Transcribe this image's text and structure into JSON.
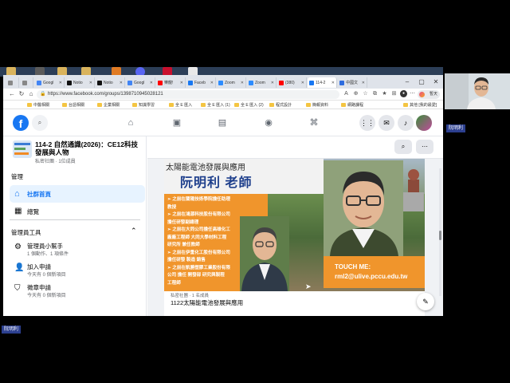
{
  "browser": {
    "tabs": [
      {
        "label": "Googl",
        "color": "#4285f4"
      },
      {
        "label": "Notio",
        "color": "#111111"
      },
      {
        "label": "Notio",
        "color": "#111111"
      },
      {
        "label": "Googl",
        "color": "#4285f4"
      },
      {
        "label": "樂龍!",
        "color": "#ff0000"
      },
      {
        "label": "Faceb",
        "color": "#1877f2"
      },
      {
        "label": "Zoom",
        "color": "#2d8cff"
      },
      {
        "label": "Zoom",
        "color": "#2d8cff"
      },
      {
        "label": "(380)",
        "color": "#ff0000"
      },
      {
        "label": "114-2",
        "color": "#1877f2",
        "active": true
      },
      {
        "label": "中國文",
        "color": "#2d6cdf"
      }
    ],
    "url": "https://www.facebook.com/groups/1398710945028121",
    "profile_label": "暫天",
    "bookmarks": [
      "中醫相關",
      "台語相關",
      "企業相關",
      "知識學習",
      "全 E 匯入",
      "全 E 匯入 (1)",
      "全 E 匯入 (2)",
      "程式設計",
      "簡報資料",
      "網路課程"
    ],
    "bookmarks_more": "其他 [我的最愛]"
  },
  "facebook": {
    "logo": "f",
    "group": {
      "name": "114-2 自然通識(2026)：CE12科技發展與人物",
      "meta": "私密社團 · 1位成員"
    },
    "sidebar": {
      "admin_heading": "管理",
      "home_label": "社群首頁",
      "overview_label": "總覽",
      "tools_heading": "管理員工具",
      "items": [
        {
          "label": "管理員小幫手",
          "sub": "1 個動作、1 項條件"
        },
        {
          "label": "加入申請",
          "sub": "今天有 0 個新項目"
        },
        {
          "label": "徵章申請",
          "sub": "今天有 0 個新項目"
        }
      ]
    },
    "banner": {
      "title": "太陽能電池發展與應用",
      "speaker": "阮明利  老師",
      "bio": [
        "➢ 之前在蘭陽技術學院擔任助理",
        "   教授",
        "➢ 之前在鴻源科技股份有限公司",
        "   擔任研發副總理",
        "➢ 之前在大同公司擔任高雄化工",
        "   廠廠工程師 大同大學材料工程",
        "   研究所 兼任教師",
        "➢ 之前在伊重化工股份有限公司",
        "   擔任研發 製造 銷售",
        "➢ 之前在凱勝塑膠工業股份有限",
        "   公司 擔任 開發部 研究與製程",
        "   工程師"
      ],
      "touch_label": "TOUCH ME:",
      "email": "rml2@ulive.pccu.edu.tw"
    },
    "post": {
      "meta": "私密社團 · 1 名成員",
      "title": "1122太陽能電池發展與應用"
    }
  },
  "webcam": {
    "name": "阮明利"
  }
}
